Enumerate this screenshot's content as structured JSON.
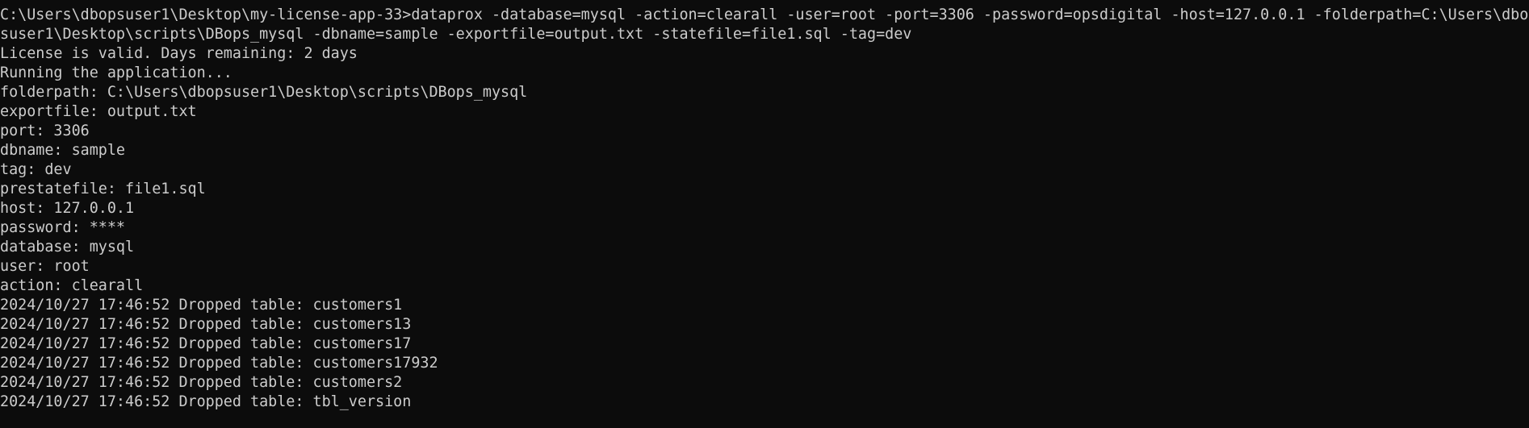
{
  "terminal": {
    "background_color": "#0c0c0c",
    "text_color": "#cccccc",
    "lines": [
      "C:\\Users\\dbopsuser1\\Desktop\\my-license-app-33>dataprox -database=mysql -action=clearall -user=root -port=3306 -password=opsdigital -host=127.0.0.1 -folderpath=C:\\Users\\dbop",
      "suser1\\Desktop\\scripts\\DBops_mysql -dbname=sample -exportfile=output.txt -statefile=file1.sql -tag=dev",
      "License is valid. Days remaining: 2 days",
      "Running the application...",
      "folderpath: C:\\Users\\dbopsuser1\\Desktop\\scripts\\DBops_mysql",
      "exportfile: output.txt",
      "port: 3306",
      "dbname: sample",
      "tag: dev",
      "prestatefile: file1.sql",
      "host: 127.0.0.1",
      "password: ****",
      "database: mysql",
      "user: root",
      "action: clearall",
      "2024/10/27 17:46:52 Dropped table: customers1",
      "2024/10/27 17:46:52 Dropped table: customers13",
      "2024/10/27 17:46:52 Dropped table: customers17",
      "2024/10/27 17:46:52 Dropped table: customers17932",
      "2024/10/27 17:46:52 Dropped table: customers2",
      "2024/10/27 17:46:52 Dropped table: tbl_version"
    ]
  }
}
